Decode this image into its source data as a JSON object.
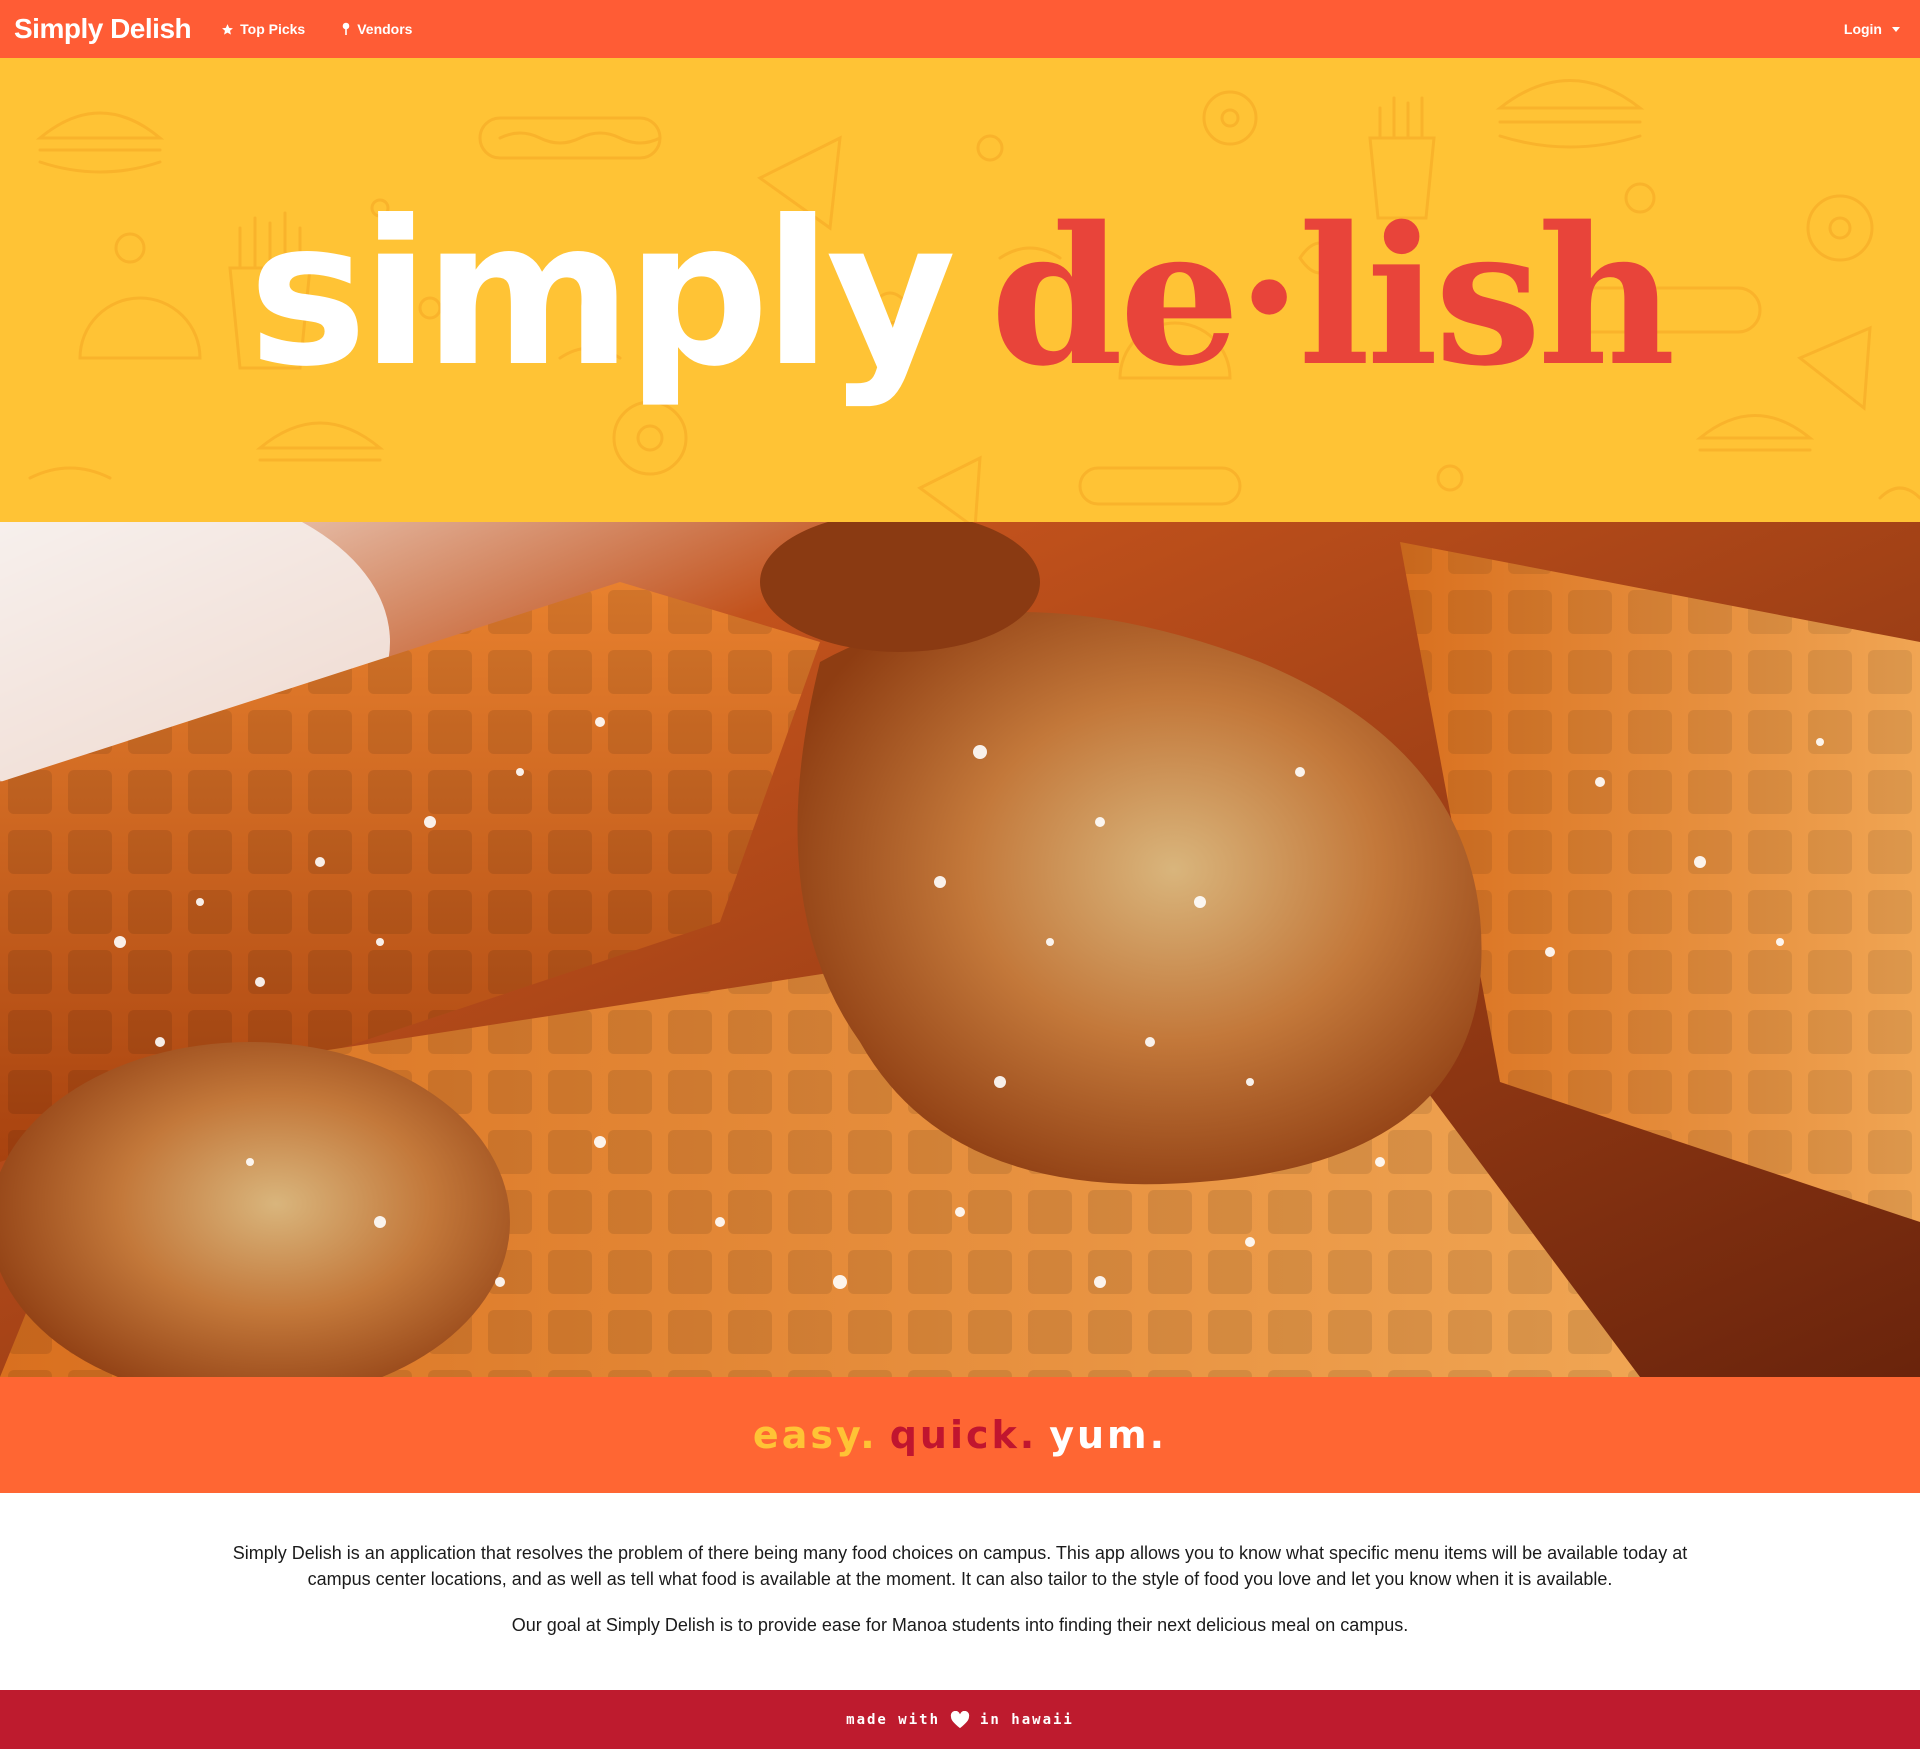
{
  "navbar": {
    "brand": "Simply Delish",
    "items": [
      {
        "label": "Top Picks",
        "icon": "star-icon"
      },
      {
        "label": "Vendors",
        "icon": "map-pin-icon"
      }
    ],
    "login_label": "Login"
  },
  "hero": {
    "logo_left": "simply",
    "logo_right": "de·lish"
  },
  "tagline": {
    "easy": "easy.",
    "quick": "quick.",
    "yum": "yum."
  },
  "about": {
    "paragraph_1": "Simply Delish is an application that resolves the problem of there being many food choices on campus. This app allows you to know what specific menu items will be available today at campus center locations, and as well as tell what food is available at the moment. It can also tailor to the style of food you love and let you know when it is available.",
    "paragraph_2": "Our goal at Simply Delish is to provide ease for Manoa students into finding their next delicious meal on campus."
  },
  "footer": {
    "made_with": "made with",
    "in_hawaii": "in hawaii",
    "icon": "heart-icon"
  },
  "colors": {
    "navbar": "#ff5c35",
    "hero": "#ffc335",
    "tagline_band": "#ff6633",
    "footer": "#be1b2e"
  }
}
